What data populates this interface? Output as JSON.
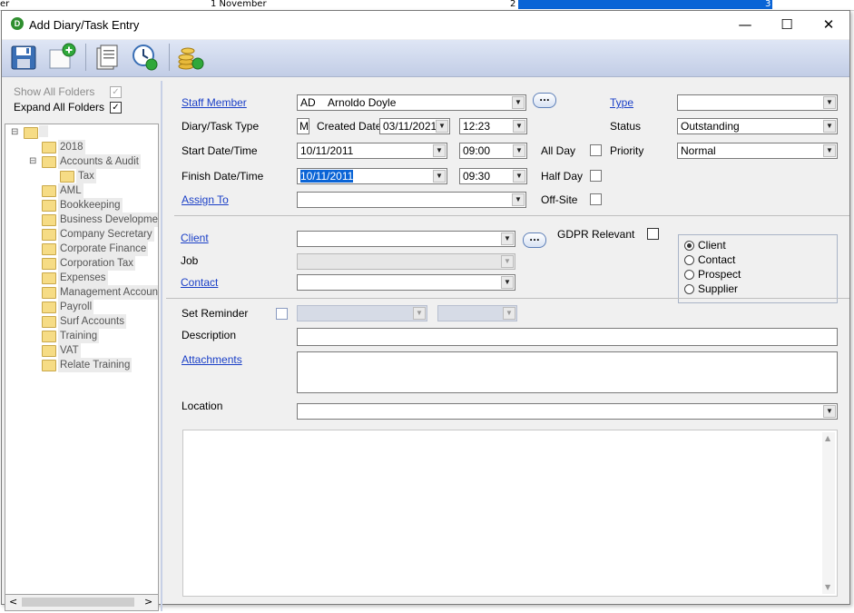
{
  "background": {
    "cell1": "er",
    "cell2": "1 November",
    "cell3": "2",
    "cell4": "3"
  },
  "window": {
    "title": "Add Diary/Task Entry",
    "icon_letter": "D",
    "minimize": "—",
    "maximize": "☐",
    "close": "✕"
  },
  "toolbar": {
    "icons": [
      "save-icon",
      "new-icon",
      "copy-document-icon",
      "time-refresh-icon",
      "fees-icon"
    ]
  },
  "left": {
    "show_all_folders": {
      "label": "Show All Folders",
      "checked": true,
      "enabled": false
    },
    "expand_all_folders": {
      "label": "Expand All Folders",
      "checked": true
    },
    "tree": {
      "root_expander": "⊟",
      "accounts_expander": "⊟",
      "items": [
        "2018",
        "Accounts & Audit",
        "Tax",
        "AML",
        "Bookkeeping",
        "Business Developmen",
        "Company Secretary",
        "Corporate Finance",
        "Corporation Tax",
        "Expenses",
        "Management Account",
        "Payroll",
        "Surf Accounts",
        "Training",
        "VAT",
        "Relate Training"
      ]
    },
    "scroll_left": "<",
    "scroll_right": ">"
  },
  "form": {
    "staff_member": {
      "label": "Staff Member",
      "code": "AD",
      "name": "Arnoldo Doyle",
      "button": "..."
    },
    "type": {
      "label": "Type",
      "value": ""
    },
    "diary_task_type": {
      "label": "Diary/Task Type",
      "value": "M"
    },
    "created_date": {
      "label": "Created Date",
      "date": "03/11/2021",
      "time": "12:23"
    },
    "status": {
      "label": "Status",
      "value": "Outstanding"
    },
    "start": {
      "label": "Start Date/Time",
      "date": "10/11/2011",
      "time": "09:00"
    },
    "all_day": {
      "label": "All Day",
      "checked": false
    },
    "priority": {
      "label": "Priority",
      "value": "Normal"
    },
    "finish": {
      "label": "Finish Date/Time",
      "date": "10/11/2011",
      "time": "09:30"
    },
    "half_day": {
      "label": "Half Day",
      "checked": false
    },
    "assign_to": {
      "label": "Assign To",
      "value": ""
    },
    "off_site": {
      "label": "Off-Site",
      "checked": false
    },
    "client": {
      "label": "Client",
      "value": "",
      "button": "..."
    },
    "gdpr": {
      "label": "GDPR Relevant",
      "checked": false
    },
    "job": {
      "label": "Job",
      "value": ""
    },
    "contact": {
      "label": "Contact",
      "value": ""
    },
    "entity_options": [
      "Client",
      "Contact",
      "Prospect",
      "Supplier"
    ],
    "entity_selected": "Client",
    "set_reminder": {
      "label": "Set Reminder",
      "checked": false
    },
    "description": {
      "label": "Description",
      "value": ""
    },
    "attachments": {
      "label": "Attachments"
    },
    "location": {
      "label": "Location",
      "value": ""
    }
  },
  "dropdown_glyph": "▼",
  "scroll_up_glyph": "▲",
  "scroll_down_glyph": "▼"
}
